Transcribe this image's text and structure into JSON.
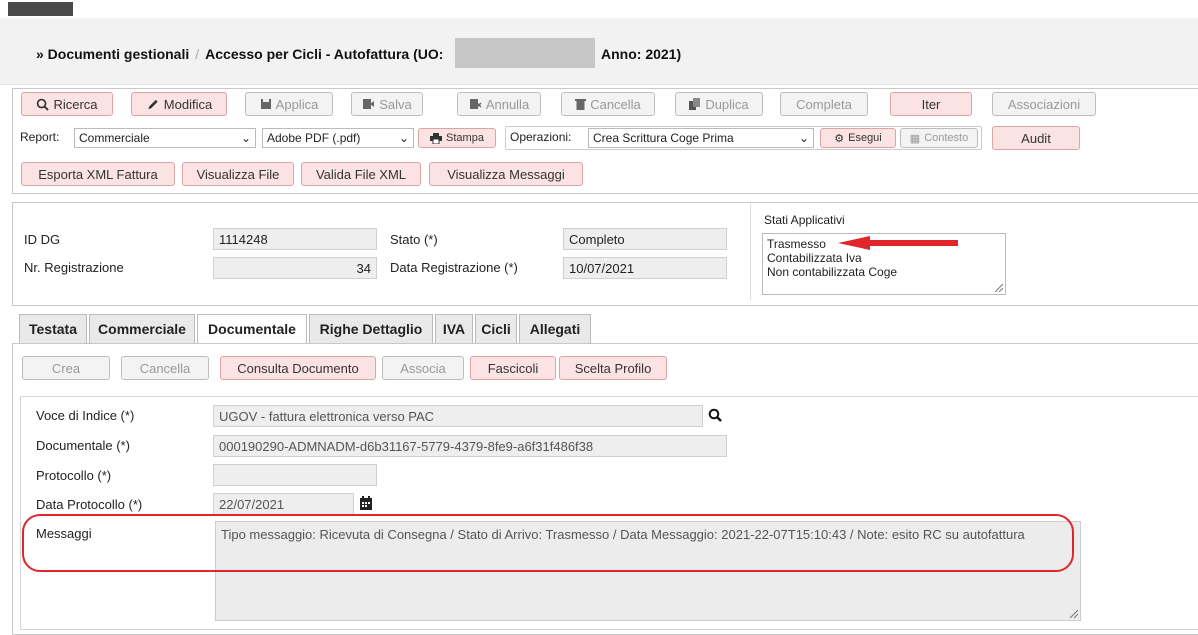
{
  "breadcrumb": {
    "root": "» Documenti gestionali",
    "separator": "/",
    "page": "Accesso per Cicli - Autofattura (UO:",
    "anno": "Anno: 2021)"
  },
  "toolbar": {
    "ricerca": "Ricerca",
    "modifica": "Modifica",
    "applica": "Applica",
    "salva": "Salva",
    "annulla": "Annulla",
    "cancella": "Cancella",
    "duplica": "Duplica",
    "completa": "Completa",
    "iter": "Iter",
    "associazioni": "Associazioni",
    "report_label": "Report:",
    "report_value": "Commerciale",
    "format_value": "Adobe PDF (.pdf)",
    "stampa": "Stampa",
    "operazioni_label": "Operazioni:",
    "operazioni_value": "Crea Scrittura Coge Prima",
    "esegui": "Esegui",
    "contesto": "Contesto",
    "audit": "Audit",
    "esporta_xml": "Esporta XML Fattura",
    "visualizza_file": "Visualizza File",
    "valida_xml": "Valida File XML",
    "visualizza_messaggi": "Visualizza Messaggi"
  },
  "summary": {
    "id_label": "ID DG",
    "id_value": "1114248",
    "nr_label": "Nr. Registrazione",
    "nr_value": "34",
    "stato_label": "Stato (*)",
    "stato_value": "Completo",
    "data_label": "Data Registrazione (*)",
    "data_value": "10/07/2021",
    "stati_title": "Stati Applicativi",
    "stati": [
      "Trasmesso",
      "Contabilizzata Iva",
      "Non contabilizzata Coge"
    ]
  },
  "tabs": [
    "Testata",
    "Commerciale",
    "Documentale",
    "Righe Dettaglio",
    "IVA",
    "Cicli",
    "Allegati"
  ],
  "doc_actions": {
    "crea": "Crea",
    "cancella": "Cancella",
    "consulta": "Consulta Documento",
    "associa": "Associa",
    "fascicoli": "Fascicoli",
    "scelta_profilo": "Scelta Profilo"
  },
  "form": {
    "voce_label": "Voce di Indice (*)",
    "voce_value": "UGOV - fattura elettronica verso PAC",
    "documentale_label": "Documentale (*)",
    "documentale_value": "000190290-ADMNADM-d6b31167-5779-4379-8fe9-a6f31f486f38",
    "protocollo_label": "Protocollo (*)",
    "protocollo_value": "",
    "data_protocollo_label": "Data Protocollo (*)",
    "data_protocollo_value": "22/07/2021",
    "messaggi_label": "Messaggi",
    "messaggi_value": "Tipo messaggio: Ricevuta di Consegna / Stato di Arrivo: Trasmesso / Data Messaggio: 2021-22-07T15:10:43 / Note: esito RC su autofattura"
  },
  "colors": {
    "pink_button": "#fbe3e3",
    "highlight_red": "#e0262b"
  }
}
